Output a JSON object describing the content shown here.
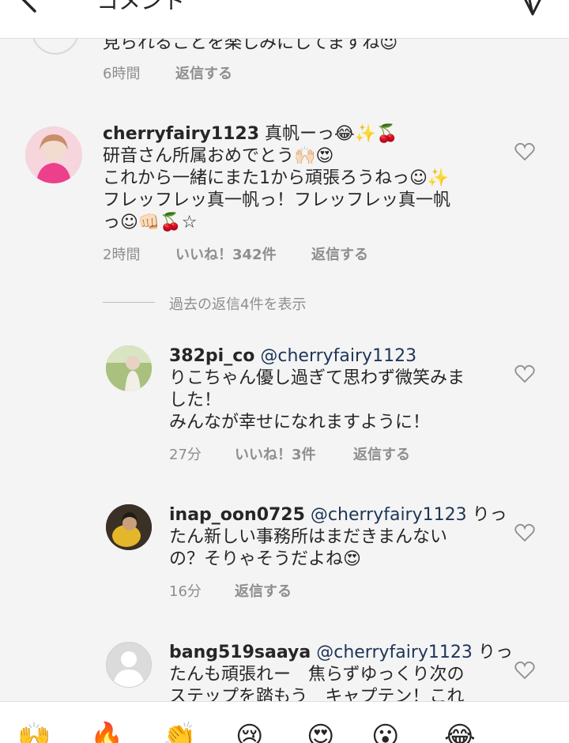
{
  "header": {
    "title": "コメント",
    "back_icon": "arrow-left-icon",
    "send_icon": "send-icon"
  },
  "top_comment": {
    "text": "見られることを楽しみにしてますね☺",
    "time": "6時間",
    "reply": "返信する"
  },
  "main_comment": {
    "username": "cherryfairy1123",
    "line1": "真帆ーっ😂✨🍒",
    "line2": "研音さん所属おめでとう🙌🏻😍",
    "line3": "これから一緒にまた1から頑張ろうねっ☺✨",
    "line4": "フレッフレッ真一帆っ！フレッフレッ真一帆",
    "line5": "っ☺👊🏻🍒☆",
    "time": "2時間",
    "likes": "いいね！342件",
    "reply": "返信する"
  },
  "view_replies": "過去の返信4件を表示",
  "replies": [
    {
      "username": "382pi_co",
      "mention": "@cherryfairy1123",
      "line1_rest": "",
      "line2": "りこちゃん優し過ぎて思わず微笑みま",
      "line3": "した！",
      "line4": "みんなが幸せになれますように！",
      "time": "27分",
      "likes": "いいね！3件",
      "reply": "返信する"
    },
    {
      "username": "inap_oon0725",
      "mention": "@cherryfairy1123",
      "line1_rest": "りっ",
      "line2": "たん新しい事務所はまだきまんない",
      "line3": "の？そりゃそうだよね😍",
      "time": "16分",
      "reply": "返信する"
    },
    {
      "username": "bang519saaya",
      "mention": "@cherryfairy1123",
      "line1_rest": "りっ",
      "line2": "たんも頑張れー　焦らずゆっくり次の",
      "line3": "ステップを踏もう　キャプテン！これ"
    }
  ],
  "emoji_bar": [
    "🙌",
    "🔥",
    "👏",
    "😢",
    "😍",
    "😮",
    "😂"
  ],
  "colors": {
    "background": "#f4f4f4",
    "text": "#262626",
    "meta": "#8e8e8e",
    "mention": "#1d3557"
  }
}
